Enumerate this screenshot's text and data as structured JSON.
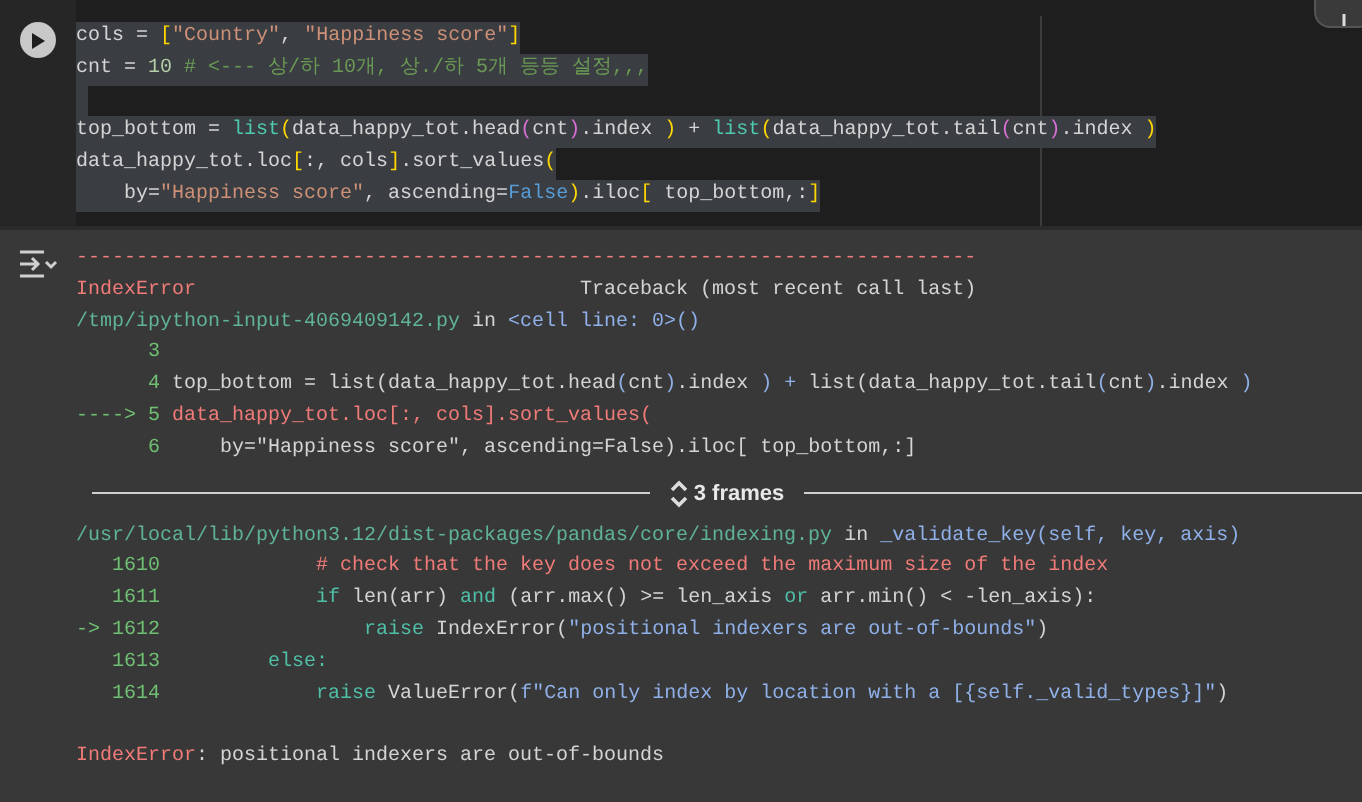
{
  "code_cell": {
    "lines": [
      {
        "segments": [
          {
            "text": "cols = ",
            "kind": "plain"
          },
          {
            "text": "[",
            "kind": "bracket"
          },
          {
            "text": "\"Country\"",
            "kind": "string"
          },
          {
            "text": ", ",
            "kind": "plain"
          },
          {
            "text": "\"Happiness score\"",
            "kind": "string"
          },
          {
            "text": "]",
            "kind": "bracket"
          }
        ]
      },
      {
        "segments": [
          {
            "text": "cnt = ",
            "kind": "plain"
          },
          {
            "text": "10",
            "kind": "number"
          },
          {
            "text": " # <--- 상/하 10개, 상./하 5개 등등 설정,,,",
            "kind": "comment"
          }
        ]
      },
      {
        "kind": "blank"
      },
      {
        "segments": [
          {
            "text": "top_bottom = ",
            "kind": "plain"
          },
          {
            "text": "list",
            "kind": "builtin"
          },
          {
            "text": "(",
            "kind": "bracket"
          },
          {
            "text": "data_happy_tot.head",
            "kind": "plain"
          },
          {
            "text": "(",
            "kind": "paren"
          },
          {
            "text": "cnt",
            "kind": "plain"
          },
          {
            "text": ")",
            "kind": "paren"
          },
          {
            "text": ".index ",
            "kind": "plain"
          },
          {
            "text": ")",
            "kind": "bracket"
          },
          {
            "text": " + ",
            "kind": "plain"
          },
          {
            "text": "list",
            "kind": "builtin"
          },
          {
            "text": "(",
            "kind": "bracket"
          },
          {
            "text": "data_happy_tot.tail",
            "kind": "plain"
          },
          {
            "text": "(",
            "kind": "paren"
          },
          {
            "text": "cnt",
            "kind": "plain"
          },
          {
            "text": ")",
            "kind": "paren"
          },
          {
            "text": ".index ",
            "kind": "plain"
          },
          {
            "text": ")",
            "kind": "bracket"
          }
        ]
      },
      {
        "segments": [
          {
            "text": "data_happy_tot.loc",
            "kind": "plain"
          },
          {
            "text": "[",
            "kind": "bracket"
          },
          {
            "text": ":, cols",
            "kind": "plain"
          },
          {
            "text": "]",
            "kind": "bracket"
          },
          {
            "text": ".sort_values",
            "kind": "plain"
          },
          {
            "text": "(",
            "kind": "bracket"
          }
        ]
      },
      {
        "segments": [
          {
            "text": "    by=",
            "kind": "plain"
          },
          {
            "text": "\"Happiness score\"",
            "kind": "string"
          },
          {
            "text": ", ascending=",
            "kind": "plain"
          },
          {
            "text": "False",
            "kind": "constant"
          },
          {
            "text": ")",
            "kind": "bracket"
          },
          {
            "text": ".iloc",
            "kind": "plain"
          },
          {
            "text": "[",
            "kind": "bracket"
          },
          {
            "text": " top_bottom,:",
            "kind": "plain"
          },
          {
            "text": "]",
            "kind": "bracket"
          }
        ]
      }
    ]
  },
  "output": {
    "lines": [
      {
        "segments": [
          {
            "text": "---------------------------------------------------------------------------",
            "kind": "error"
          }
        ]
      },
      {
        "segments": [
          {
            "text": "IndexError",
            "kind": "error"
          },
          {
            "text": "                                Traceback (most recent call last)",
            "kind": "plain"
          }
        ]
      },
      {
        "segments": [
          {
            "text": "/tmp/ipython-input-4069409142.py",
            "kind": "path"
          },
          {
            "text": " in ",
            "kind": "plain"
          },
          {
            "text": "<cell line: 0>()",
            "kind": "name"
          }
        ]
      },
      {
        "segments": [
          {
            "text": "      3",
            "kind": "lineno"
          }
        ]
      },
      {
        "segments": [
          {
            "text": "      4",
            "kind": "lineno"
          },
          {
            "text": " top_bottom = list(data_happy_tot.head",
            "kind": "plain"
          },
          {
            "text": "(",
            "kind": "name"
          },
          {
            "text": "cnt",
            "kind": "plain"
          },
          {
            "text": ")",
            "kind": "name"
          },
          {
            "text": ".index ",
            "kind": "plain"
          },
          {
            "text": ")",
            "kind": "name"
          },
          {
            "text": " + ",
            "kind": "name"
          },
          {
            "text": "list(data_happy_tot.tail",
            "kind": "plain"
          },
          {
            "text": "(",
            "kind": "name"
          },
          {
            "text": "cnt",
            "kind": "plain"
          },
          {
            "text": ")",
            "kind": "name"
          },
          {
            "text": ".index ",
            "kind": "plain"
          },
          {
            "text": ")",
            "kind": "name"
          }
        ]
      },
      {
        "segments": [
          {
            "text": "----> 5",
            "kind": "lineno"
          },
          {
            "text": " data_happy_tot.loc[:, cols].sort_values(",
            "kind": "error"
          }
        ]
      },
      {
        "segments": [
          {
            "text": "      6",
            "kind": "lineno"
          },
          {
            "text": "     by=\"Happiness score\", ascending=False).iloc[ top_bottom,:]",
            "kind": "plain"
          }
        ]
      }
    ],
    "frames_toggle": "3 frames",
    "frame_lines": [
      {
        "segments": [
          {
            "text": "/usr/local/lib/python3.12/dist-packages/pandas/core/indexing.py",
            "kind": "path"
          },
          {
            "text": " in ",
            "kind": "plain"
          },
          {
            "text": "_validate_key(self, key, axis)",
            "kind": "name"
          }
        ]
      },
      {
        "segments": [
          {
            "text": "   1610",
            "kind": "lineno"
          },
          {
            "text": "             # check that the key does not exceed the maximum size of the index",
            "kind": "error"
          }
        ]
      },
      {
        "segments": [
          {
            "text": "   1611",
            "kind": "lineno"
          },
          {
            "text": "             if",
            "kind": "keyword"
          },
          {
            "text": " len(arr) ",
            "kind": "plain"
          },
          {
            "text": "and",
            "kind": "keyword"
          },
          {
            "text": " (arr.max() >= len_axis ",
            "kind": "plain"
          },
          {
            "text": "or",
            "kind": "keyword"
          },
          {
            "text": " arr.min() < -len_axis):",
            "kind": "plain"
          }
        ]
      },
      {
        "segments": [
          {
            "text": "-> 1612",
            "kind": "lineno"
          },
          {
            "text": "                 raise",
            "kind": "keyword"
          },
          {
            "text": " IndexError(",
            "kind": "plain"
          },
          {
            "text": "\"positional indexers are out-of-bounds\"",
            "kind": "name"
          },
          {
            "text": ")",
            "kind": "plain"
          }
        ]
      },
      {
        "segments": [
          {
            "text": "   1613",
            "kind": "lineno"
          },
          {
            "text": "         else:",
            "kind": "keyword"
          }
        ]
      },
      {
        "segments": [
          {
            "text": "   1614",
            "kind": "lineno"
          },
          {
            "text": "             raise",
            "kind": "keyword"
          },
          {
            "text": " ValueError(",
            "kind": "plain"
          },
          {
            "text": "f\"Can only index by location with a [{self._valid_types}]\"",
            "kind": "name"
          },
          {
            "text": ")",
            "kind": "plain"
          }
        ]
      }
    ],
    "error_line": {
      "segments": [
        {
          "text": "IndexError",
          "kind": "error"
        },
        {
          "text": ": positional indexers are out-of-bounds",
          "kind": "plain"
        }
      ]
    }
  }
}
